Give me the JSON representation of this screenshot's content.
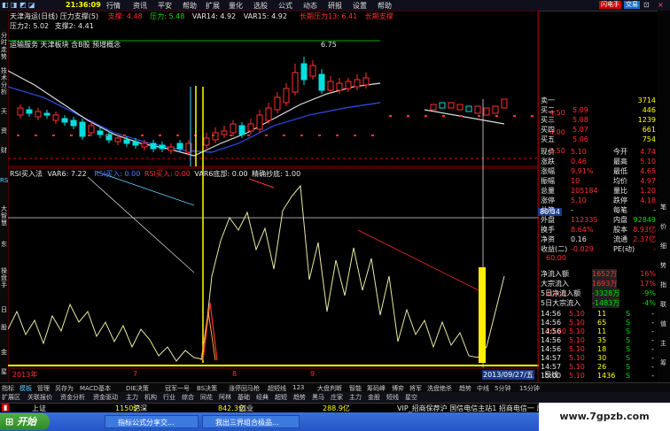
{
  "menu": {
    "icons_left": [
      "◧",
      "◨",
      "◩",
      "◪"
    ],
    "clock": "21:36:09",
    "items": [
      "行情",
      "资讯",
      "平安",
      "帮助",
      "扩展",
      "量化",
      "选股",
      "公式",
      "动态",
      "研报",
      "设置",
      "帮助"
    ],
    "buttons": [
      "闪电手",
      "交易",
      "⊡",
      "×"
    ]
  },
  "chart_header": {
    "stock_name": "天津海运(日线)",
    "indicator": "压力支撑(5)",
    "support_label": "支撑: 4.48",
    "pressure_label": "压力: 5.48",
    "var14": "VAR14: 4.92",
    "var15": "VAR15: 4.92",
    "long_pressure": "长期压力13: 6.41",
    "long_support": "长期支撑",
    "pressure2": "压力2: 5.02",
    "support2": "支撑2: 4.41",
    "sector": "运输服务 天津板块 含B股 预增概念",
    "high_label": "6.75"
  },
  "rsi_header": {
    "rsi_buy": "RSI买入法",
    "var6": "VAR6: 7.22",
    "rsi_in": "RSI买入: 0.00",
    "rsi_buy2": "RSI买入: 0.00",
    "var6_bottom": "VAR6底部: 0.00",
    "precise": "精确抄底: 1.00"
  },
  "y_axis": {
    "price_labels": [
      "4.50",
      "4.00",
      "3.50",
      "3.00"
    ],
    "rsi_labels": [
      "80.34",
      "60.00",
      "40.00",
      "20.00"
    ]
  },
  "x_axis": {
    "labels": [
      "2013年",
      "7",
      "8",
      "9",
      "2013/09/27/五"
    ],
    "day_label": "日线"
  },
  "quote": {
    "sell_rows": [
      {
        "label": "卖一",
        "price": "",
        "vol": "3714"
      },
      {
        "label": "买二",
        "price": "5.09",
        "vol": "446"
      },
      {
        "label": "买三",
        "price": "5.08",
        "vol": "1239"
      },
      {
        "label": "买四",
        "price": "5.07",
        "vol": "661"
      },
      {
        "label": "买五",
        "price": "5.06",
        "vol": "754"
      }
    ],
    "rows": [
      {
        "l1": "现价",
        "v1": "5.10",
        "l2": "今开",
        "v2": "4.74"
      },
      {
        "l1": "涨跌",
        "v1": "0.46",
        "l2": "最高",
        "v2": "5.10"
      },
      {
        "l1": "涨幅",
        "v1": "9.91%",
        "l2": "最低",
        "v2": "4.65"
      },
      {
        "l1": "振幅",
        "v1": "10",
        "l2": "均价",
        "v2": "4.97"
      },
      {
        "l1": "总量",
        "v1": "205184",
        "l2": "量比",
        "v2": "1.20"
      },
      {
        "l1": "涨停",
        "v1": "5.10",
        "l2": "跌停",
        "v2": "4.18"
      },
      {
        "l1": "总笔",
        "v1": "-",
        "l2": "每笔",
        "v2": "-"
      },
      {
        "l1": "外盘",
        "v1": "112335",
        "l2": "内盘",
        "v2": "92849"
      },
      {
        "l1": "换手",
        "v1": "8.64%",
        "l2": "股本",
        "v2": "8.93亿"
      },
      {
        "l1": "净资",
        "v1": "0.16",
        "l2": "流通",
        "v2": "2.37亿"
      },
      {
        "l1": "收益(二)",
        "v1": "-0.029",
        "l2": "PE(动)",
        "v2": "-"
      }
    ],
    "flow_rows": [
      {
        "label": "净流入额",
        "value": "1652万",
        "pct": "16%"
      },
      {
        "label": "大宗流入",
        "value": "1693万",
        "pct": "17%"
      },
      {
        "label": "5日净流入额",
        "value": "-3328万",
        "pct": "-9%"
      },
      {
        "label": "5日大宗流入",
        "value": "-1483万",
        "pct": "-4%"
      }
    ],
    "ticks": [
      {
        "time": "14:56",
        "price": "5.10",
        "vol": "11",
        "dir": "S",
        "n": "-"
      },
      {
        "time": "14:56",
        "price": "5.10",
        "vol": "65",
        "dir": "S",
        "n": "-"
      },
      {
        "time": "14:56",
        "price": "5.10",
        "vol": "11",
        "dir": "S",
        "n": "-"
      },
      {
        "time": "14:56",
        "price": "5.10",
        "vol": "35",
        "dir": "S",
        "n": "-"
      },
      {
        "time": "14:56",
        "price": "5.10",
        "vol": "18",
        "dir": "S",
        "n": "-"
      },
      {
        "time": "14:57",
        "price": "5.10",
        "vol": "30",
        "dir": "S",
        "n": "-"
      },
      {
        "time": "14:57",
        "price": "5.10",
        "vol": "26",
        "dir": "S",
        "n": "-"
      },
      {
        "time": "15:00",
        "price": "5.10",
        "vol": "1436",
        "dir": "S",
        "n": "-"
      }
    ],
    "bottom_tabs": [
      "笔",
      "价",
      "细",
      "势",
      "指",
      "联",
      "值",
      "主",
      "筹"
    ]
  },
  "left_tabs": [
    "分时走势",
    "技术分析",
    "天",
    "资",
    "财",
    "RS",
    "大智慧",
    "东",
    "操盘手",
    "日",
    "股",
    "金",
    "星"
  ],
  "bottom_tabs_row1": [
    "指标",
    "模板",
    "管理",
    "另存为",
    "MACD基本",
    "DIE决策",
    "冠军一号",
    "BS决策",
    "涨停回马枪",
    "超短线",
    "123",
    "大盘判断",
    "智能",
    "筹码峰",
    "博弈",
    "将军",
    "洗盘绝杀",
    "趋势",
    "中线",
    "5分钟",
    "15分钟",
    "30分钟",
    "60分钟",
    "日线",
    "周线",
    "月线",
    "多日",
    "1分钟",
    "5分钟",
    "15分钟",
    "30分钟",
    "60分钟"
  ],
  "bottom_tabs_row2": [
    "扩展区",
    "关联报价",
    "资金分析",
    "资金驱动",
    "主力",
    "机构",
    "行业",
    "综合",
    "同花",
    "阿林",
    "基础",
    "经典",
    "超短",
    "趋势",
    "黑马",
    "庄家",
    "主力",
    "金股",
    "短线",
    "星空"
  ],
  "status": {
    "market1": "上证",
    "value1": "1150亿",
    "market2": "沪深",
    "value2": "842.3亿",
    "market3": "创业",
    "value3": "288.9亿",
    "info": "VIP_招商保荐沪 国信电信主站1 招商电信一 周二 21:"
  },
  "taskbar": {
    "start": "开始",
    "apps": [
      "指标公式分享交...",
      "我出三界组合极品..."
    ]
  },
  "watermark": "www.7gpzb.com",
  "colors": {
    "up": "#ff3030",
    "down": "#00e0e0",
    "yellow": "#ffff00",
    "green": "#00e000"
  }
}
